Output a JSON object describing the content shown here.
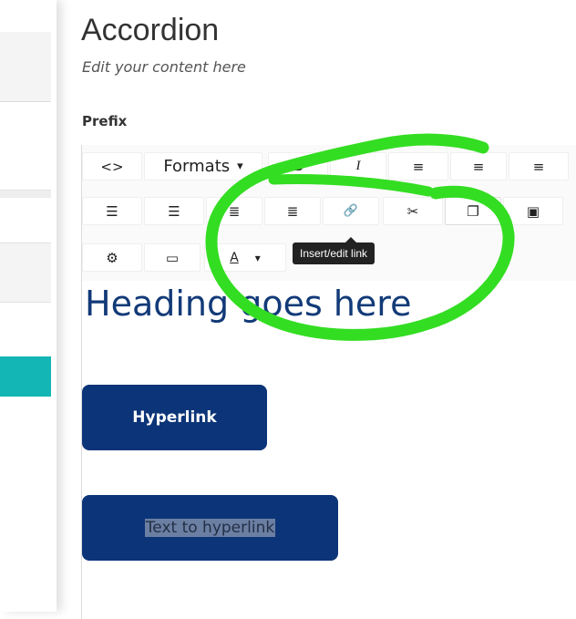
{
  "page": {
    "title": "Accordion",
    "subtitle": "Edit your content here",
    "field_label": "Prefix"
  },
  "toolbar": {
    "row1": {
      "source_code": "<>",
      "formats_label": "Formats",
      "formats_caret": "▾",
      "bold": "B",
      "italic": "I",
      "align_left": "≡",
      "align_center": "≡",
      "align_right": "≡"
    },
    "row2": {
      "bullet_list": "☰",
      "numbered_list": "☰",
      "outdent": "≣",
      "indent": "≣",
      "link": "🔗",
      "unlink": "✂",
      "bookmark": "❐",
      "image": "▣"
    },
    "row3": {
      "settings": "⚙",
      "preview": "▭",
      "text_color": "A",
      "text_color_caret": "▾"
    },
    "tooltip": "Insert/edit link"
  },
  "content": {
    "heading": "Heading goes here",
    "button_hyperlink": "Hyperlink",
    "button_text_to_hyperlink": "Text to hyperlink"
  },
  "colors": {
    "heading": "#123a78",
    "button_bg": "#0c3478",
    "teal_block": "#13b5b5",
    "annotation": "#33dd22"
  }
}
